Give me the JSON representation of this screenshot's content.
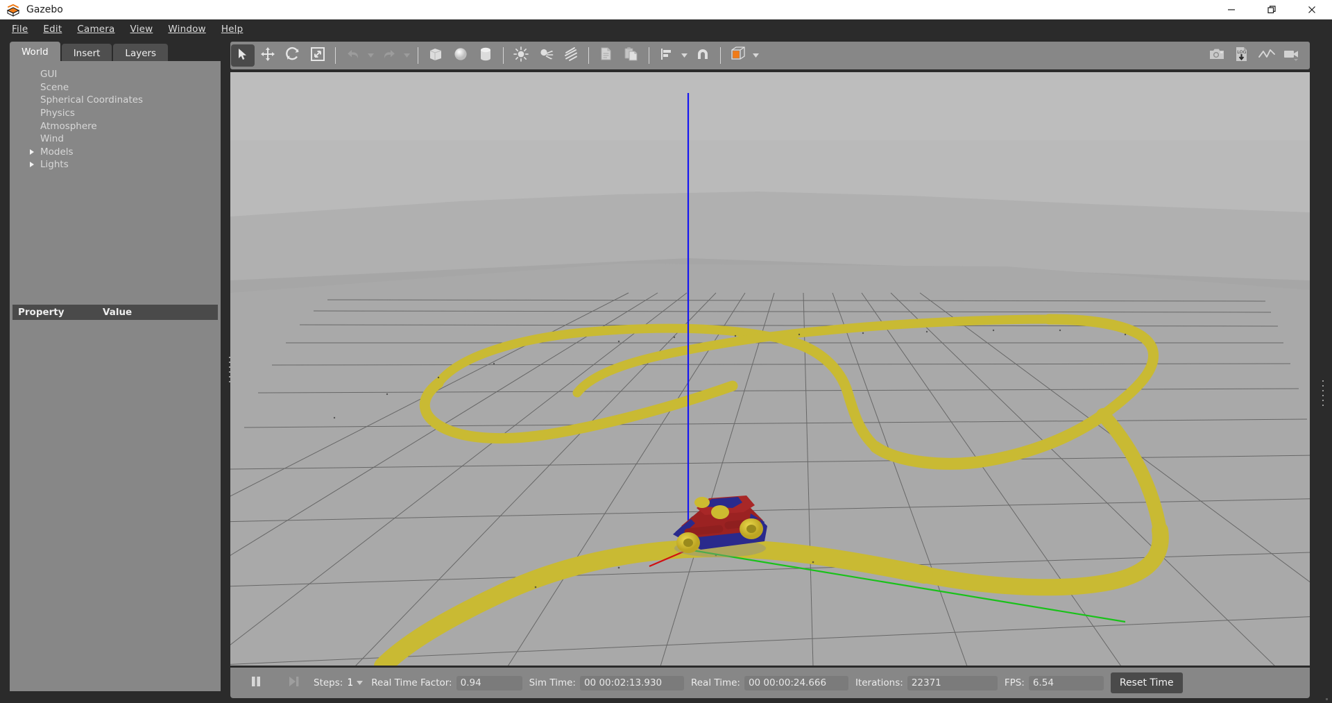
{
  "window": {
    "title": "Gazebo",
    "app_icon": "gazebo-logo-icon",
    "minimize_label": "—",
    "restore_label": "❐",
    "close_label": "✕"
  },
  "menubar": {
    "items": [
      {
        "label": "File",
        "mnemonic": "F"
      },
      {
        "label": "Edit",
        "mnemonic": "E"
      },
      {
        "label": "Camera",
        "mnemonic": "C"
      },
      {
        "label": "View",
        "mnemonic": "V"
      },
      {
        "label": "Window",
        "mnemonic": "W"
      },
      {
        "label": "Help",
        "mnemonic": "H"
      }
    ]
  },
  "left_dock": {
    "tabs": [
      {
        "label": "World",
        "active": true
      },
      {
        "label": "Insert",
        "active": false
      },
      {
        "label": "Layers",
        "active": false
      }
    ],
    "tree": [
      {
        "label": "GUI",
        "expandable": false
      },
      {
        "label": "Scene",
        "expandable": false
      },
      {
        "label": "Spherical Coordinates",
        "expandable": false
      },
      {
        "label": "Physics",
        "expandable": false
      },
      {
        "label": "Atmosphere",
        "expandable": false
      },
      {
        "label": "Wind",
        "expandable": false
      },
      {
        "label": "Models",
        "expandable": true
      },
      {
        "label": "Lights",
        "expandable": true
      }
    ],
    "property_table": {
      "columns": [
        "Property",
        "Value"
      ],
      "rows": []
    }
  },
  "toolbar": {
    "left_tools": [
      {
        "name": "select-mode-icon",
        "label": "Selection Mode",
        "active": true
      },
      {
        "name": "translate-mode-icon",
        "label": "Translation Mode",
        "active": false
      },
      {
        "name": "rotate-mode-icon",
        "label": "Rotation Mode",
        "active": false
      },
      {
        "name": "scale-mode-icon",
        "label": "Scale Mode",
        "active": false
      },
      {
        "name": "undo-icon",
        "label": "Undo",
        "active": false
      },
      {
        "name": "redo-icon",
        "label": "Redo",
        "active": false
      },
      {
        "name": "box-icon",
        "label": "Box",
        "active": false
      },
      {
        "name": "sphere-icon",
        "label": "Sphere",
        "active": false
      },
      {
        "name": "cylinder-icon",
        "label": "Cylinder",
        "active": false
      },
      {
        "name": "point-light-icon",
        "label": "Point Light",
        "active": false
      },
      {
        "name": "spot-light-icon",
        "label": "Spot Light",
        "active": false
      },
      {
        "name": "directional-light-icon",
        "label": "Directional Light",
        "active": false
      },
      {
        "name": "copy-icon",
        "label": "Copy",
        "active": false
      },
      {
        "name": "paste-icon",
        "label": "Paste",
        "active": false
      },
      {
        "name": "align-icon",
        "label": "Align",
        "active": false
      },
      {
        "name": "snap-icon",
        "label": "Snap",
        "active": false
      },
      {
        "name": "view-angle-icon",
        "label": "Change the view angle",
        "active": false
      }
    ],
    "right_tools": [
      {
        "name": "screenshot-icon",
        "label": "Take a screenshot"
      },
      {
        "name": "log-icon",
        "label": "Save logs",
        "badge": "LOG"
      },
      {
        "name": "plot-icon",
        "label": "Open plotting window"
      },
      {
        "name": "record-video-icon",
        "label": "Record a video"
      }
    ]
  },
  "statusbar": {
    "play_pause": {
      "name": "pause-button",
      "state": "pause"
    },
    "step": {
      "name": "step-button",
      "label": "Step"
    },
    "steps_label": "Steps:",
    "steps_value": "1",
    "fields": [
      {
        "label": "Real Time Factor:",
        "value": "0.94",
        "name": "real-time-factor"
      },
      {
        "label": "Sim Time:",
        "value": "00 00:02:13.930",
        "name": "sim-time"
      },
      {
        "label": "Real Time:",
        "value": "00 00:00:24.666",
        "name": "real-time"
      },
      {
        "label": "Iterations:",
        "value": "22371",
        "name": "iterations"
      },
      {
        "label": "FPS:",
        "value": "6.54",
        "name": "fps"
      }
    ],
    "reset_button": "Reset Time"
  },
  "scene": {
    "name": "gazebo-3d-viewport",
    "sky_top_color": "#bcbcbc",
    "sky_bottom_color": "#a9a9a9",
    "ground_color": "#a9a9a9",
    "grid_color": "#5d5d5d",
    "track_color": "#c9ba33",
    "axis_z_color": "#1515f0",
    "axis_y_color": "#19c219",
    "axis_x_color": "#d01010",
    "model_body_color": "#9b2222",
    "model_accent_color": "#2a2a8c",
    "model_wheel_color": "#d4c234",
    "description": "Yellow line-follower track on a gridded ground plane with a small red and blue car model at the world origin"
  },
  "colors": {
    "panel_bg": "#878787",
    "dock_bg": "#2b2b2b",
    "toolbar_bg": "#878787",
    "accent_orange": "#f07b18",
    "titlebar_bg": "#ffffff"
  }
}
